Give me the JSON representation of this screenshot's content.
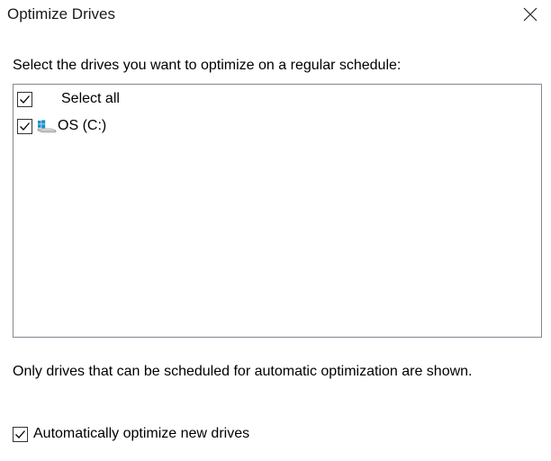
{
  "window": {
    "title": "Optimize Drives",
    "close_icon": "close-icon"
  },
  "instruction": "Select the drives you want to optimize on a regular schedule:",
  "drive_list": {
    "items": [
      {
        "label": "Select all",
        "checked": true,
        "icon": ""
      },
      {
        "label": "OS (C:)",
        "checked": true,
        "icon": "windows-drive-icon"
      }
    ]
  },
  "note": "Only drives that can be scheduled for automatic optimization are shown.",
  "auto_optimize": {
    "label": "Automatically optimize new drives",
    "checked": true
  },
  "colors": {
    "accent_blue": "#1e90c8",
    "border": "#828790"
  }
}
